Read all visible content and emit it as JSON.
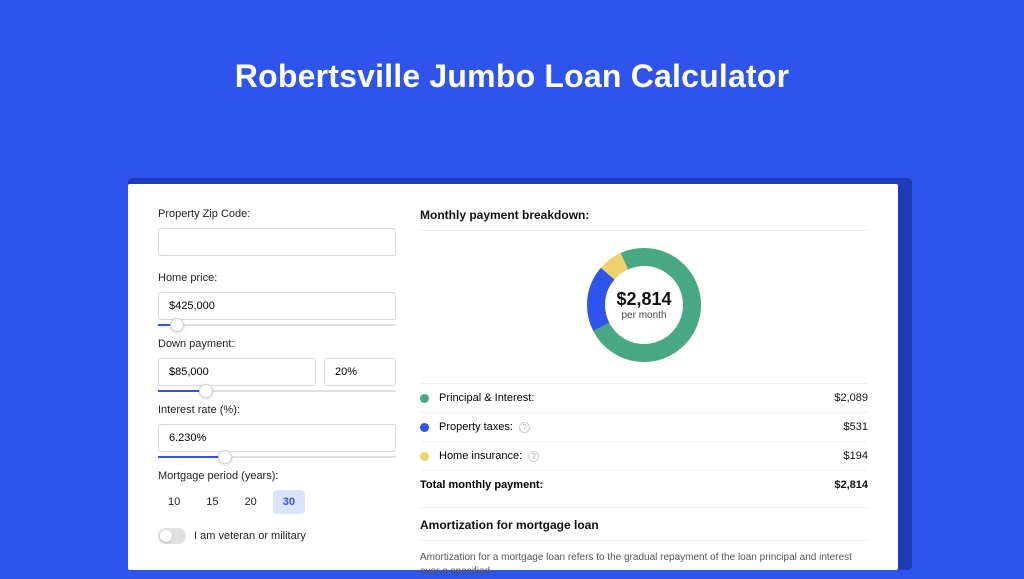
{
  "title": "Robertsville Jumbo Loan Calculator",
  "form": {
    "zip_label": "Property Zip Code:",
    "zip_value": "",
    "home_price_label": "Home price:",
    "home_price_value": "$425,000",
    "home_price_slider_pct": 8,
    "down_payment_label": "Down payment:",
    "down_payment_value": "$85,000",
    "down_payment_pct_value": "20%",
    "down_payment_slider_pct": 20,
    "rate_label": "Interest rate (%):",
    "rate_value": "6.230%",
    "rate_slider_pct": 28,
    "period_label": "Mortgage period (years):",
    "periods": [
      "10",
      "15",
      "20",
      "30"
    ],
    "period_selected_index": 3,
    "veteran_label": "I am veteran or military"
  },
  "breakdown": {
    "header": "Monthly payment breakdown:",
    "center_amount": "$2,814",
    "center_sub": "per month",
    "rows": [
      {
        "label": "Principal & Interest:",
        "value": "$2,089",
        "color": "#49a884",
        "info": false
      },
      {
        "label": "Property taxes:",
        "value": "$531",
        "color": "#2e54eb",
        "info": true
      },
      {
        "label": "Home insurance:",
        "value": "$194",
        "color": "#efd06b",
        "info": true
      }
    ],
    "total_label": "Total monthly payment:",
    "total_value": "$2,814"
  },
  "amortization": {
    "header": "Amortization for mortgage loan",
    "body": "Amortization for a mortgage loan refers to the gradual repayment of the loan principal and interest over a specified"
  },
  "chart_data": {
    "type": "pie",
    "title": "Monthly payment breakdown",
    "series": [
      {
        "name": "Principal & Interest",
        "value": 2089,
        "color": "#49a884"
      },
      {
        "name": "Property taxes",
        "value": 531,
        "color": "#2e54eb"
      },
      {
        "name": "Home insurance",
        "value": 194,
        "color": "#efd06b"
      }
    ],
    "total": 2814,
    "center_label": "$2,814 per month"
  }
}
